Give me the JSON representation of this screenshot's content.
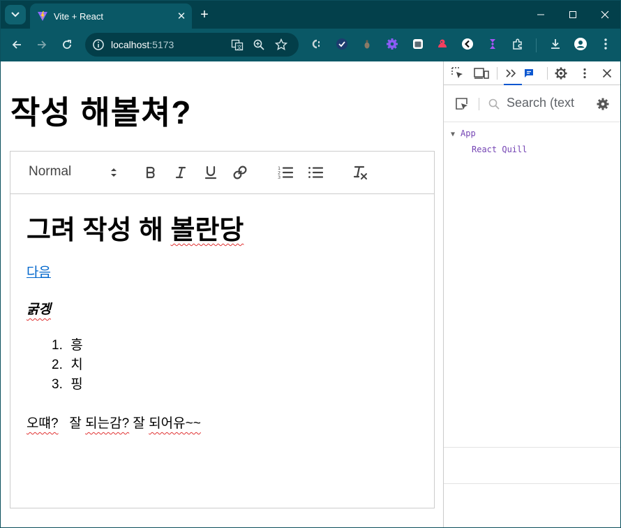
{
  "browser": {
    "tab": {
      "title": "Vite + React",
      "favicon": "vite-logo-icon"
    },
    "url": {
      "host": "localhost",
      "port": ":5173"
    },
    "colors": {
      "frame": "#03404b",
      "toolbar": "#0a5866",
      "omnibox": "#033e49"
    }
  },
  "page": {
    "title": "작성 해볼쳐?"
  },
  "editor": {
    "header_picker": "Normal",
    "content": {
      "heading": "그려 작성 해 볼란당",
      "link": "다음",
      "bold_italic": "굵겡",
      "list": [
        {
          "num": "1.",
          "text": "흥"
        },
        {
          "num": "2.",
          "text": "치"
        },
        {
          "num": "3.",
          "text": "핑"
        }
      ],
      "last_line": "오떄?   잘 되는감? 잘 되어유~~"
    }
  },
  "devtools": {
    "search_placeholder": "Search (text",
    "tree": {
      "root": "App",
      "child": "React Quill"
    },
    "colors": {
      "active_tab": "#0b57d0",
      "component_name": "#7545b4"
    }
  }
}
